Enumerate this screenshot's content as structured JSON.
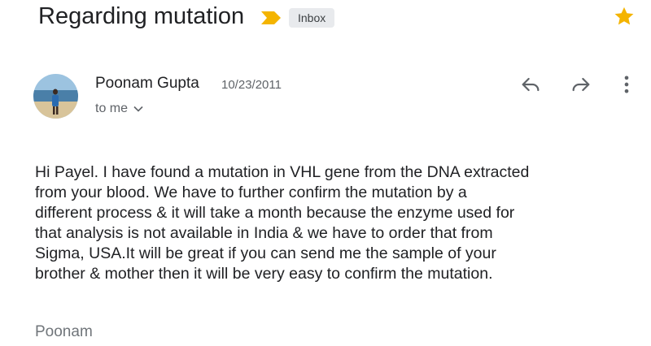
{
  "email": {
    "subject": "Regarding mutation",
    "label": "Inbox",
    "sender_name": "Poonam Gupta",
    "date": "10/23/2011",
    "recipient": "to me",
    "body": "Hi Payel. I have found a mutation in VHL gene from the DNA extracted\nfrom your blood. We have to further confirm the mutation by a\ndifferent process & it will take a month because the enzyme used for\nthat analysis is not available in India & we have to order that from\nSigma, USA.It will be great if you can send me the sample of your\nbrother & mother then it will be very easy  to confirm the mutation.",
    "signature": "Poonam"
  },
  "icons": {
    "importance": "importance-marker-icon",
    "star": "star-icon",
    "reply": "reply-icon",
    "forward": "forward-icon",
    "more": "more-vert-icon",
    "expand": "chevron-down-icon"
  },
  "colors": {
    "importance": "#f4b400",
    "star": "#f4b400",
    "badge_bg": "#e8eaed"
  }
}
